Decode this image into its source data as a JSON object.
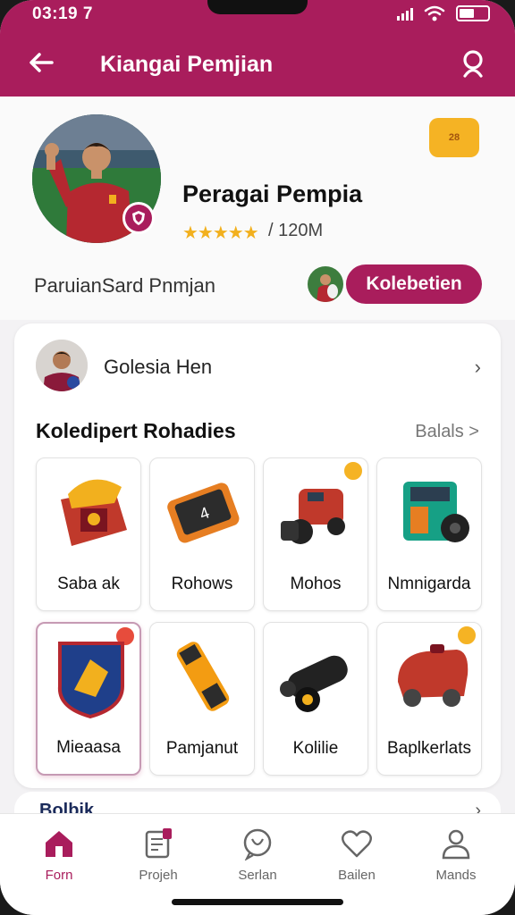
{
  "status": {
    "time": "03:19 7"
  },
  "header": {
    "title": "Kiangai Pemjian"
  },
  "profile": {
    "name": "Peragai Pempia",
    "rating_stars": "★★★★★",
    "stat": "/ 120M",
    "subtitle": "ParuianSard  Pnmjan",
    "gift_badge_text": "28",
    "collection_button": "Kolebetien"
  },
  "card": {
    "row_label": "Golesia Hen",
    "section_title": "Koledipert Rohadies",
    "section_link": "Balals >",
    "items": [
      {
        "label": "Saba ak",
        "icon": "helmet-icon"
      },
      {
        "label": "Rohows",
        "icon": "phone-card-icon"
      },
      {
        "label": "Mohos",
        "icon": "cannon-icon"
      },
      {
        "label": "Nmnigarda",
        "icon": "machine-icon"
      },
      {
        "label": "Mieaasa",
        "icon": "badge-shield-icon"
      },
      {
        "label": "Pamjanut",
        "icon": "scanner-icon"
      },
      {
        "label": "Kolilie",
        "icon": "black-cannon-icon"
      },
      {
        "label": "Baplkerlats",
        "icon": "red-vehicle-icon"
      }
    ],
    "peek_text": "Bolbik"
  },
  "nav": [
    {
      "label": "Forn",
      "icon": "home-icon",
      "active": true
    },
    {
      "label": "Projeh",
      "icon": "document-icon",
      "active": false
    },
    {
      "label": "Serlan",
      "icon": "chat-icon",
      "active": false
    },
    {
      "label": "Bailen",
      "icon": "heart-icon",
      "active": false
    },
    {
      "label": "Mands",
      "icon": "person-icon",
      "active": false
    }
  ],
  "colors": {
    "brand": "#a91d5c",
    "star": "#f2b01e",
    "gift": "#f5b324"
  }
}
